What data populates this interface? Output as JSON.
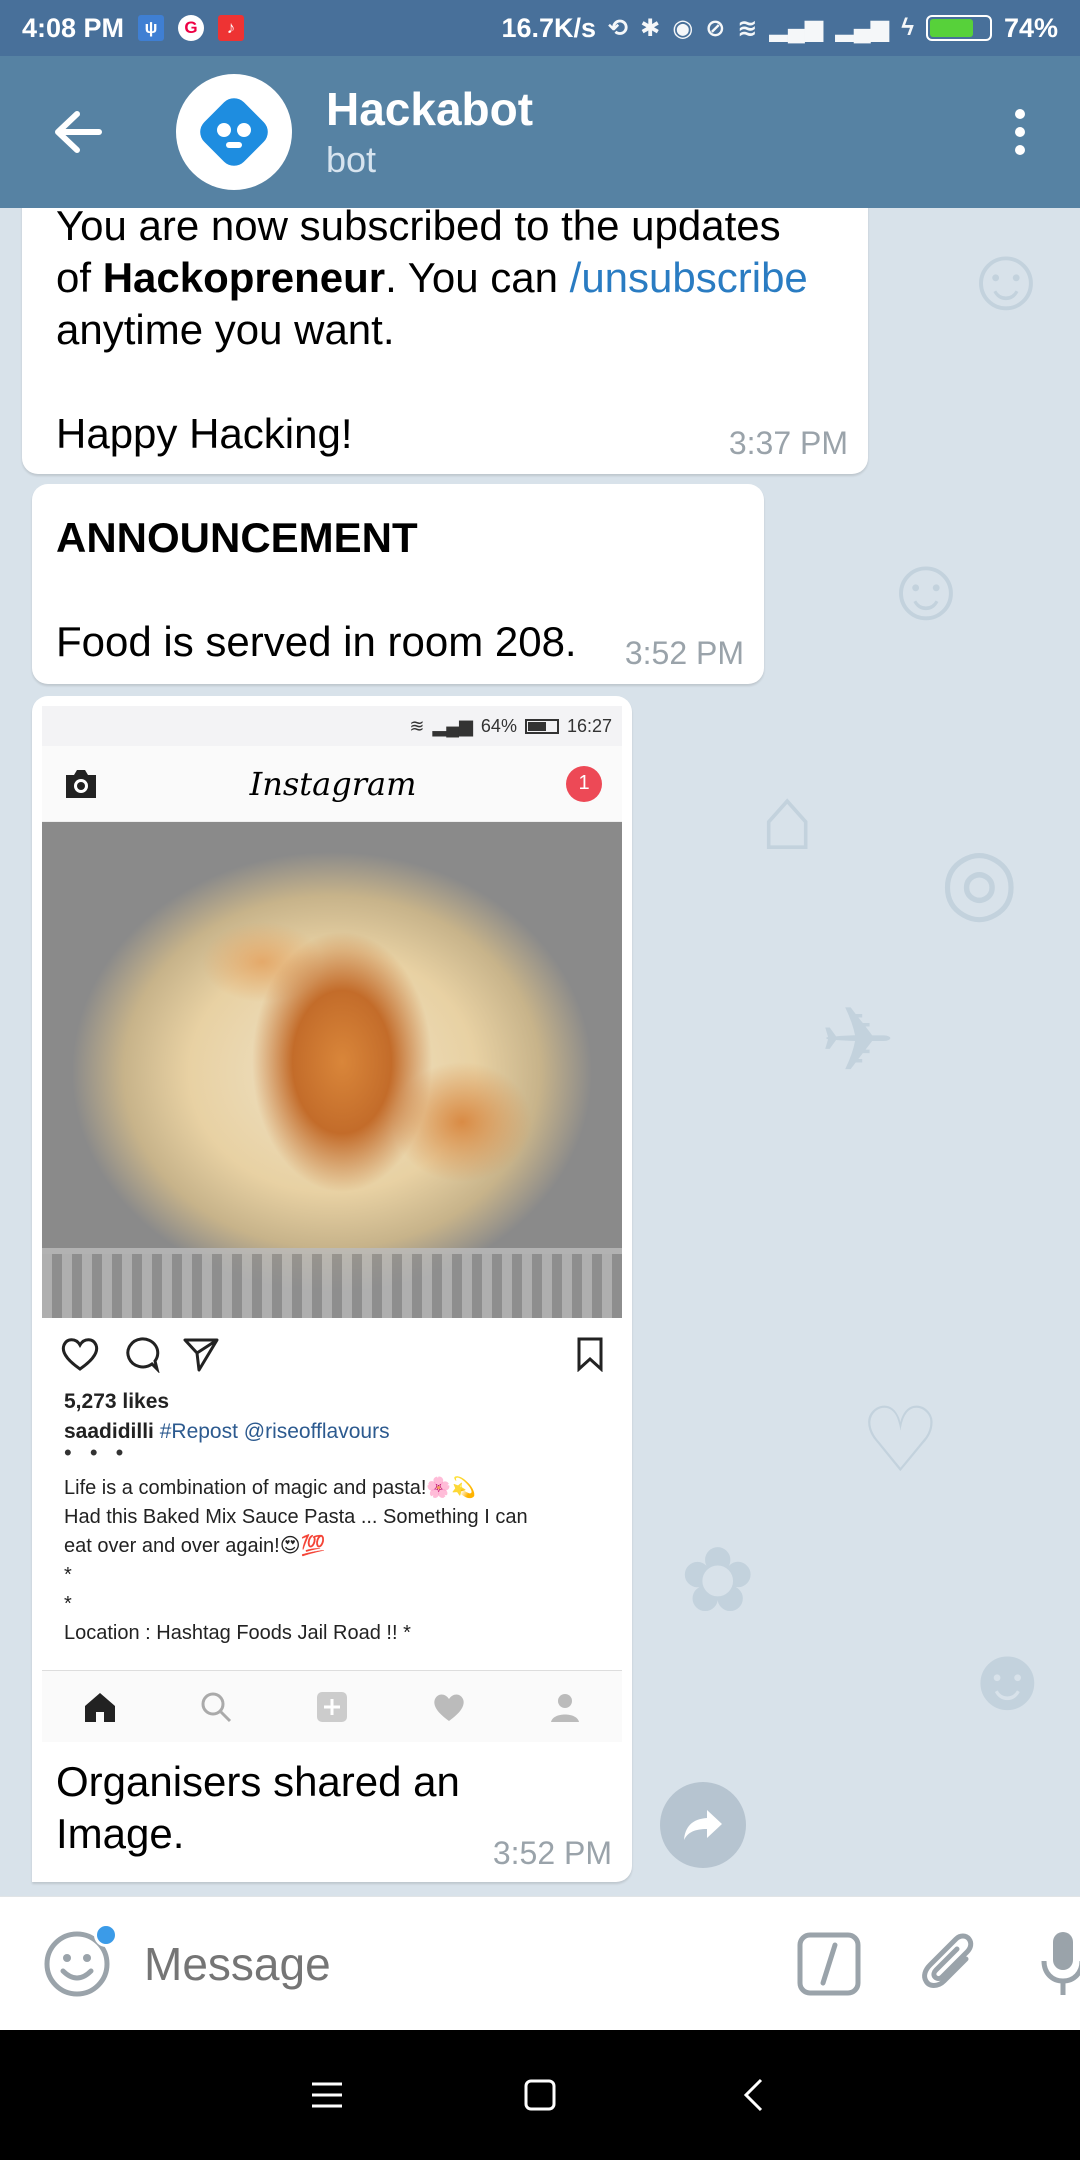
{
  "status_bar": {
    "time": "4:08 PM",
    "network_speed": "16.7K/s",
    "battery_percent": "74%",
    "battery_level": 0.74
  },
  "header": {
    "title": "Hackabot",
    "subtitle": "bot"
  },
  "messages": [
    {
      "line1": "You are now subscribed to the updates",
      "line2_prefix": "of ",
      "line2_bold": "Hackopreneur",
      "line2_mid": ". You can ",
      "line2_link": "/unsubscribe",
      "line3": "anytime you want.",
      "line4": "Happy Hacking!",
      "time": "3:37 PM"
    },
    {
      "heading": "ANNOUNCEMENT",
      "body": "Food is served in room 208.",
      "time": "3:52 PM"
    },
    {
      "caption": "Organisers shared an Image.",
      "time": "3:52 PM",
      "image": {
        "status_battery": "64%",
        "status_time": "16:27",
        "app_name": "Instagram",
        "notification_count": "1",
        "likes": "5,273 likes",
        "username": "saadidilli",
        "repost_tag": "#Repost @riseofflavours",
        "dots": "• • •",
        "caption_lines": [
          "Life is a combination of magic and pasta!🌸💫",
          "Had this Baked Mix Sauce Pasta ... Something I can",
          "eat over and over again!😍💯",
          "*",
          "*",
          "Location : Hashtag Foods Jail Road !! *"
        ]
      }
    }
  ],
  "composer": {
    "placeholder": "Message"
  },
  "colors": {
    "header_bg": "#5682a3",
    "status_bg": "#48709a",
    "chat_bg": "#d8e2ea",
    "link": "#2a7cc2"
  }
}
